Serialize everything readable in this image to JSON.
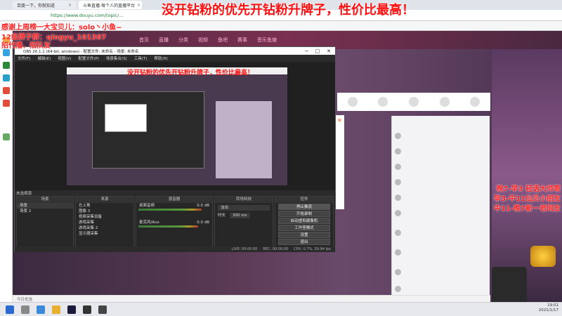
{
  "browser": {
    "tabs": [
      {
        "label": "百度一下，你就知道",
        "active": false
      },
      {
        "label": "斗鱼直播-每个人的直播平台",
        "active": true
      }
    ],
    "url": "https://www.douyu.com/topic/..."
  },
  "overlay": {
    "headline": "没开钻粉的优先开钻粉升牌子，性价比最高！",
    "line1": "感谢上周榜一大宝贝儿：solo丶小鱼~",
    "line2": "12级牌子群：qingyu_101367",
    "line3": "招代播、招队友",
    "schedule": [
      "晚7-早3  轻语大帅哥",
      "早3-中11仙贝小朋友",
      "中11-晚7新一老网友"
    ]
  },
  "douyu_nav": [
    "首页",
    "直播",
    "分类",
    "视频",
    "鱼吧",
    "赛事",
    "音乐鱼塘"
  ],
  "obs": {
    "title": "OBS 26.1.1 (64-bit, windows) - 配置文件: 未命名 - 场景: 未命名",
    "menu": [
      "文件(F)",
      "编辑(E)",
      "视图(V)",
      "配置文件(P)",
      "场景集合(S)",
      "工具(T)",
      "帮助(H)"
    ],
    "nested_headline": "没开钻粉的优先开钻粉升牌子，性价比最高！",
    "no_source_label": "未选择源",
    "docks": {
      "scenes": {
        "title": "场景",
        "items": [
          "场景",
          "场景 2"
        ]
      },
      "sources": {
        "title": "来源",
        "items": [
          "左上角",
          "图像 3",
          "视频采集设备",
          "游戏采集",
          "游戏采集 2",
          "显示器采集"
        ]
      },
      "mixer": {
        "title": "混音器",
        "channels": [
          {
            "name": "桌面音频",
            "db": "0.0 dB",
            "level": 0.9
          },
          {
            "name": "麦克风/Aux",
            "db": "0.0 dB",
            "level": 0.85
          }
        ]
      },
      "transitions": {
        "title": "转场特效",
        "type": "淡出",
        "duration_label": "时长",
        "duration": "300 ms"
      },
      "controls": {
        "title": "控件",
        "buttons": [
          "停止推流",
          "开始录制",
          "启动虚拟摄像机",
          "工作室模式",
          "设置",
          "退出"
        ]
      }
    },
    "status": [
      "LIVE: 00:00:00",
      "REC: 00:00:00",
      "CPU: 0.7%, 59.94 fps"
    ]
  },
  "statusbar": {
    "text": "今日优选"
  },
  "taskbar": {
    "time": "19:01",
    "date": "2021/1/17"
  }
}
